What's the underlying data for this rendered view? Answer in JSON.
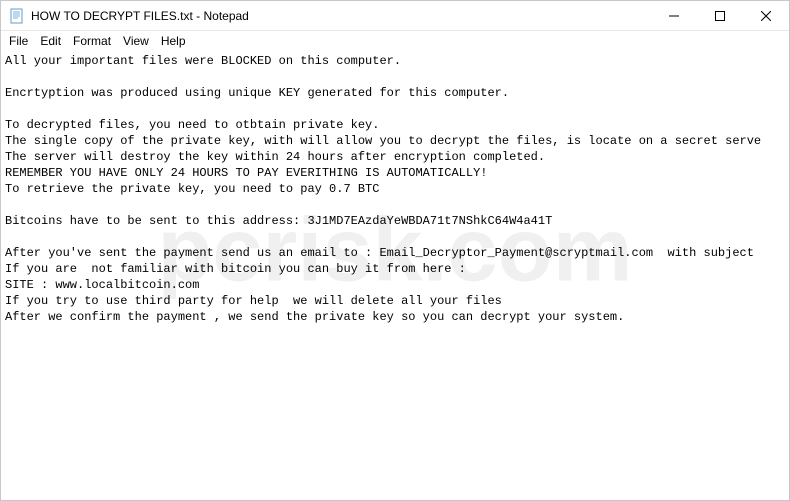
{
  "titlebar": {
    "title": "HOW TO DECRYPT FILES.txt - Notepad"
  },
  "menubar": {
    "file": "File",
    "edit": "Edit",
    "format": "Format",
    "view": "View",
    "help": "Help"
  },
  "content": {
    "line1": "All your important files were BLOCKED on this computer.",
    "line2": "",
    "line3": "Encrtyption was produced using unique KEY generated for this computer.",
    "line4": "",
    "line5": "To decrypted files, you need to otbtain private key.",
    "line6": "The single copy of the private key, with will allow you to decrypt the files, is locate on a secret serve",
    "line7": "The server will destroy the key within 24 hours after encryption completed.",
    "line8": "REMEMBER YOU HAVE ONLY 24 HOURS TO PAY EVERITHING IS AUTOMATICALLY!",
    "line9": "To retrieve the private key, you need to pay 0.7 BTC",
    "line10": "",
    "line11": "Bitcoins have to be sent to this address: 3J1MD7EAzdaYeWBDA71t7NShkC64W4a41T",
    "line12": "",
    "line13": "After you've sent the payment send us an email to : Email_Decryptor_Payment@scryptmail.com  with subject ",
    "line14": "If you are  not familiar with bitcoin you can buy it from here :",
    "line15": "SITE : www.localbitcoin.com",
    "line16": "If you try to use third party for help  we will delete all your files",
    "line17": "After we confirm the payment , we send the private key so you can decrypt your system."
  },
  "watermark": "pcrisk.com"
}
